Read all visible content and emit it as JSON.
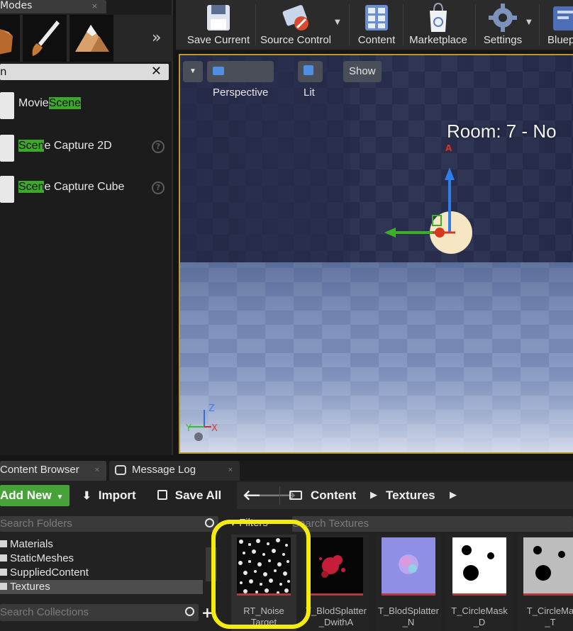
{
  "modes_panel": {
    "tab_label": "Modes",
    "tab_close": "×",
    "more_glyph": "»",
    "search_value": "n",
    "search_clear": "✕",
    "items": [
      {
        "prefix": "Movie",
        "match": "Scene",
        "suffix": "",
        "has_help": false
      },
      {
        "prefix": "",
        "match": "Scen",
        "suffix": "e Capture 2D",
        "has_help": true
      },
      {
        "prefix": "",
        "match": "Scen",
        "suffix": "e Capture Cube",
        "has_help": true
      }
    ],
    "help_glyph": "?"
  },
  "toolbar": {
    "save_current": "Save Current",
    "source_control": "Source Control",
    "content": "Content",
    "marketplace": "Marketplace",
    "settings": "Settings",
    "blueprints": "Bluep",
    "drop_glyph": "▼"
  },
  "viewport": {
    "menu_glyph": "▼",
    "perspective": "Perspective",
    "lit": "Lit",
    "show": "Show",
    "room_label": "Room: 7 - No",
    "gizmo": {
      "z": "Z",
      "y": "Y",
      "x": "X"
    },
    "arrow_tip": "A"
  },
  "content_browser": {
    "tabs": [
      {
        "label": "Content Browser",
        "close": "×"
      },
      {
        "label": "Message Log",
        "close": "×"
      }
    ],
    "add_new": "Add New",
    "import": "Import",
    "save_all": "Save All",
    "path": [
      "Content",
      "Textures"
    ],
    "search_folders_placeholder": "Search Folders",
    "folders": [
      "Materials",
      "StaticMeshes",
      "SuppliedContent",
      "Textures"
    ],
    "selected_folder": "Textures",
    "search_collections_placeholder": "Search Collections",
    "filters_label": "Filters",
    "search_assets_placeholder": "Search Textures",
    "assets": [
      {
        "name": "RT_Noise\nTarget",
        "kind": "noise"
      },
      {
        "name": "T_BlodSplatter\n_DwithA",
        "kind": "splatter-red"
      },
      {
        "name": "T_BlodSplatter\n_N",
        "kind": "splatter-normal"
      },
      {
        "name": "T_CircleMask\n_D",
        "kind": "circles-white"
      },
      {
        "name": "T_CircleMa\n_T",
        "kind": "circles-grey"
      }
    ]
  },
  "colors": {
    "accent_green": "#47a23a",
    "highlight_yellow": "#f5ec0f",
    "viewport_border": "#b89a2a",
    "search_match": "#3ea82c"
  }
}
